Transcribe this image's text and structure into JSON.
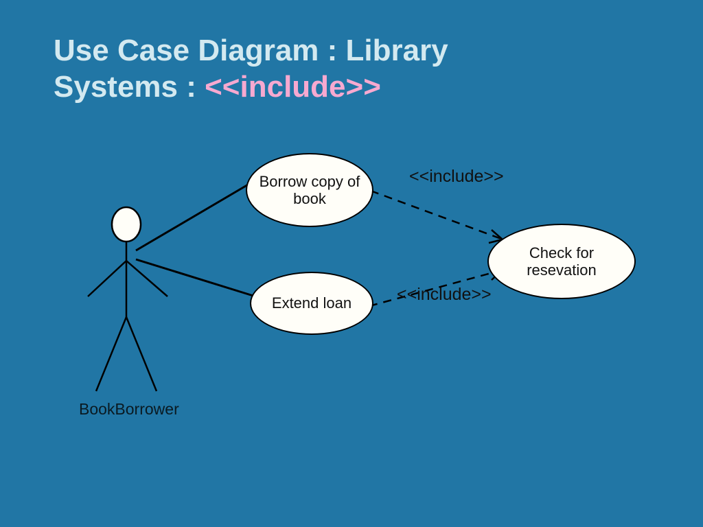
{
  "title": {
    "line1": "Use Case Diagram : Library",
    "line2_prefix": "Systems : ",
    "line2_highlight": "<<include>>"
  },
  "actor": {
    "name": "BookBorrower"
  },
  "use_cases": {
    "borrow": "Borrow copy of book",
    "extend": "Extend loan",
    "check": "Check for resevation"
  },
  "relations": {
    "include1": "<<include>>",
    "include2": "<<include>>"
  },
  "diagram_structure": {
    "actors": [
      "BookBorrower"
    ],
    "use_cases": [
      "Borrow copy of book",
      "Extend loan",
      "Check for resevation"
    ],
    "associations": [
      {
        "actor": "BookBorrower",
        "use_case": "Borrow copy of book"
      },
      {
        "actor": "BookBorrower",
        "use_case": "Extend loan"
      }
    ],
    "includes": [
      {
        "from": "Borrow copy of book",
        "to": "Check for resevation"
      },
      {
        "from": "Extend loan",
        "to": "Check for resevation"
      }
    ]
  }
}
